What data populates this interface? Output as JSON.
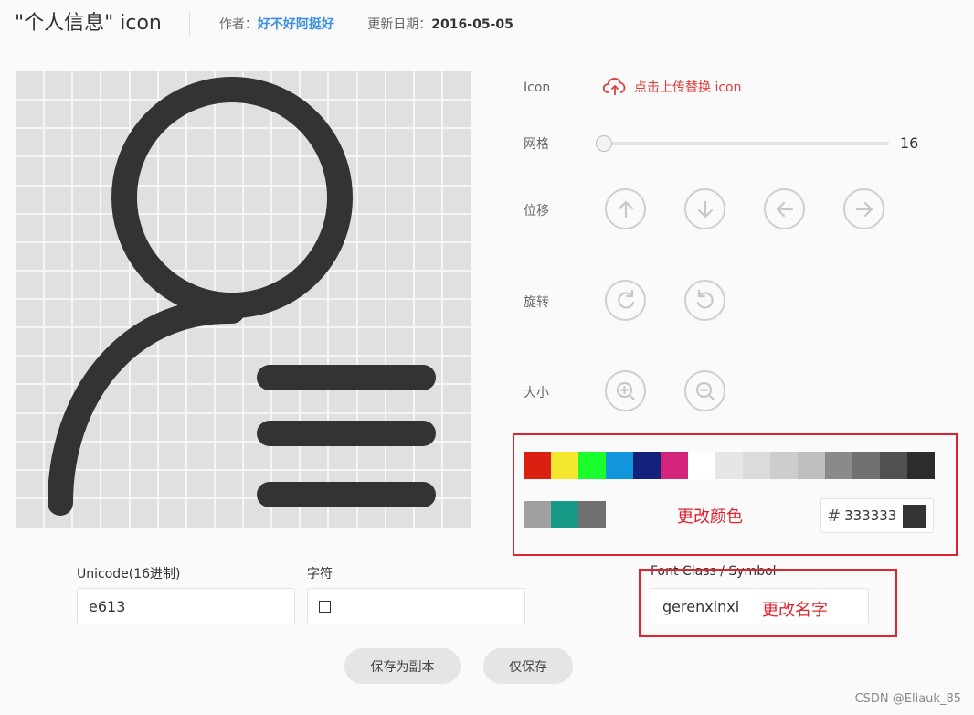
{
  "header": {
    "title": "\"个人信息\" icon",
    "author_label": "作者：",
    "author": "好不好阿挺好",
    "date_label": "更新日期：",
    "date": "2016-05-05"
  },
  "controls": {
    "icon_label": "Icon",
    "upload_text": "点击上传替换 icon",
    "grid_label": "网格",
    "grid_value": "16",
    "grid_fraction": 0,
    "move_label": "位移",
    "rotate_label": "旋转",
    "size_label": "大小"
  },
  "colors": {
    "palette_row1": [
      "#da2010",
      "#f5e62e",
      "#1aff2c",
      "#1296db",
      "#13227a",
      "#d4237a",
      "#ffffff",
      "#e6e6e6",
      "#dbdbdb",
      "#cdcdcd",
      "#bfbfbf",
      "#8a8a8a",
      "#707070",
      "#515151",
      "#2c2c2c"
    ],
    "palette_row2": [
      "#a0a0a0",
      "#179a87",
      "#707070"
    ],
    "annotation": "更改颜色",
    "hex_hash": "#",
    "hex_value": "333333",
    "current": "#333333"
  },
  "fields": {
    "unicode_label": "Unicode(16进制)",
    "unicode_value": "e613",
    "char_label": "字符",
    "char_value": "",
    "font_class_label": "Font Class / Symbol",
    "font_class_value": "gerenxinxi",
    "name_annotation": "更改名字"
  },
  "buttons": {
    "save_copy": "保存为副本",
    "save_only": "仅保存"
  },
  "watermark": "CSDN @Eliauk_85"
}
